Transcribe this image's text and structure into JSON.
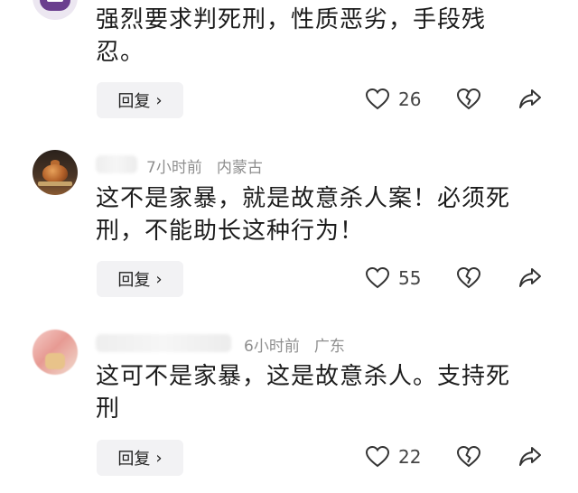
{
  "comments": [
    {
      "username": "",
      "time": "",
      "location": "",
      "text_line1": "强烈要求判死刑，性质恶劣，手段残",
      "text_line2": "忍。",
      "reply_label": "回复",
      "likes": "26"
    },
    {
      "username": "",
      "time": "7小时前",
      "location": "内蒙古",
      "text_line1": "这不是家暴，就是故意杀人案！必须死",
      "text_line2": "刑，不能助长这种行为！",
      "reply_label": "回复",
      "likes": "55"
    },
    {
      "username": "",
      "time": "6小时前",
      "location": "广东",
      "text_line1": "这可不是家暴，这是故意杀人。支持死",
      "text_line2": "刑",
      "reply_label": "回复",
      "likes": "22"
    }
  ],
  "icons": {
    "like": "heart-outline-icon",
    "dislike": "broken-heart-icon",
    "share": "share-arrow-icon",
    "reply_chevron": "chevron-right-icon"
  },
  "colors": {
    "text": "#1c1c1c",
    "meta": "#8f8f8f",
    "reply_bg": "#f2f2f4",
    "icon": "#333333"
  }
}
